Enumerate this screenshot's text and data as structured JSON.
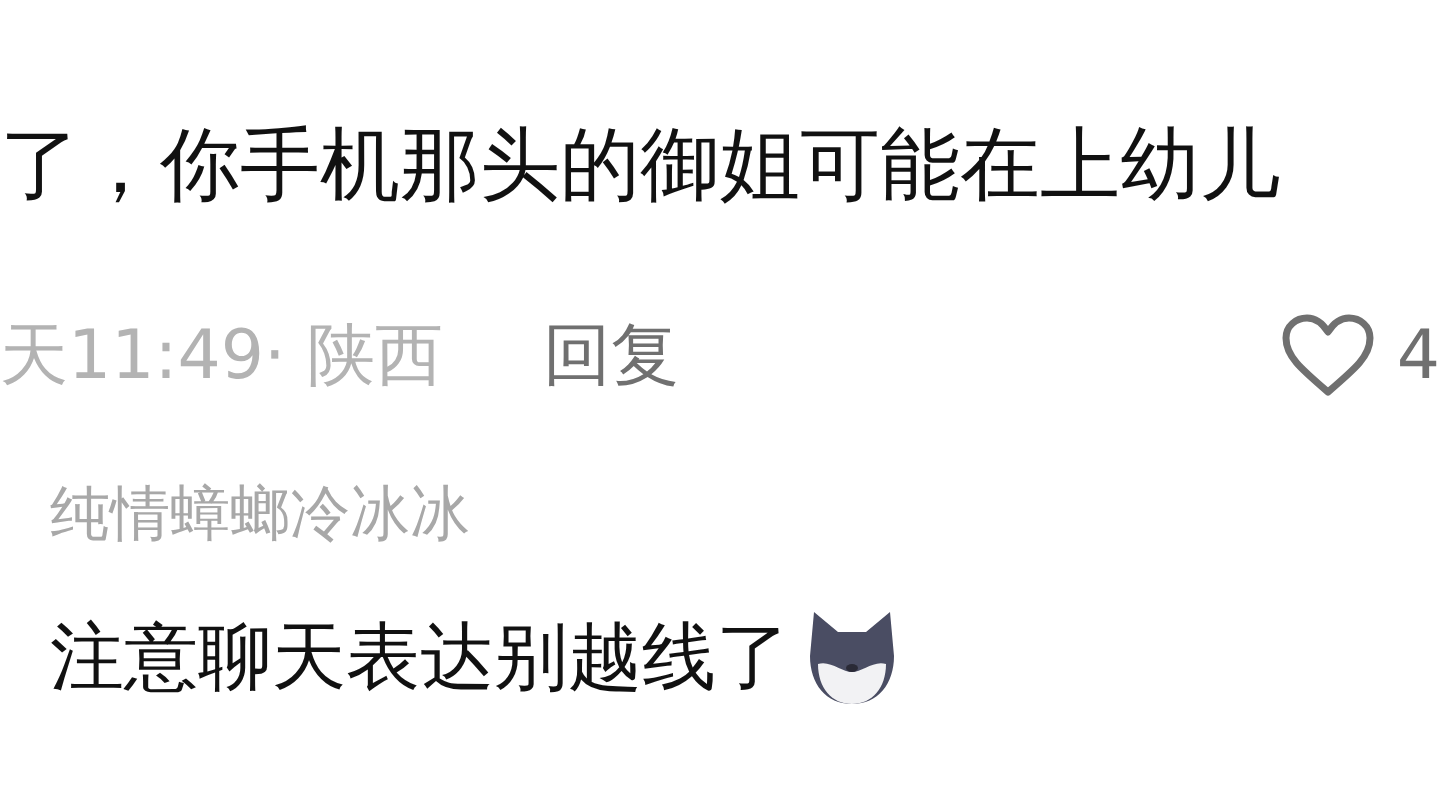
{
  "comment": {
    "text": "了，你手机那头的御姐可能在上幼儿",
    "time_location": "天11:49· 陕西",
    "reply_label": "回复",
    "likes": "4"
  },
  "reply": {
    "username": "纯情蟑螂冷冰冰",
    "text": "注意聊天表达别越线了"
  }
}
